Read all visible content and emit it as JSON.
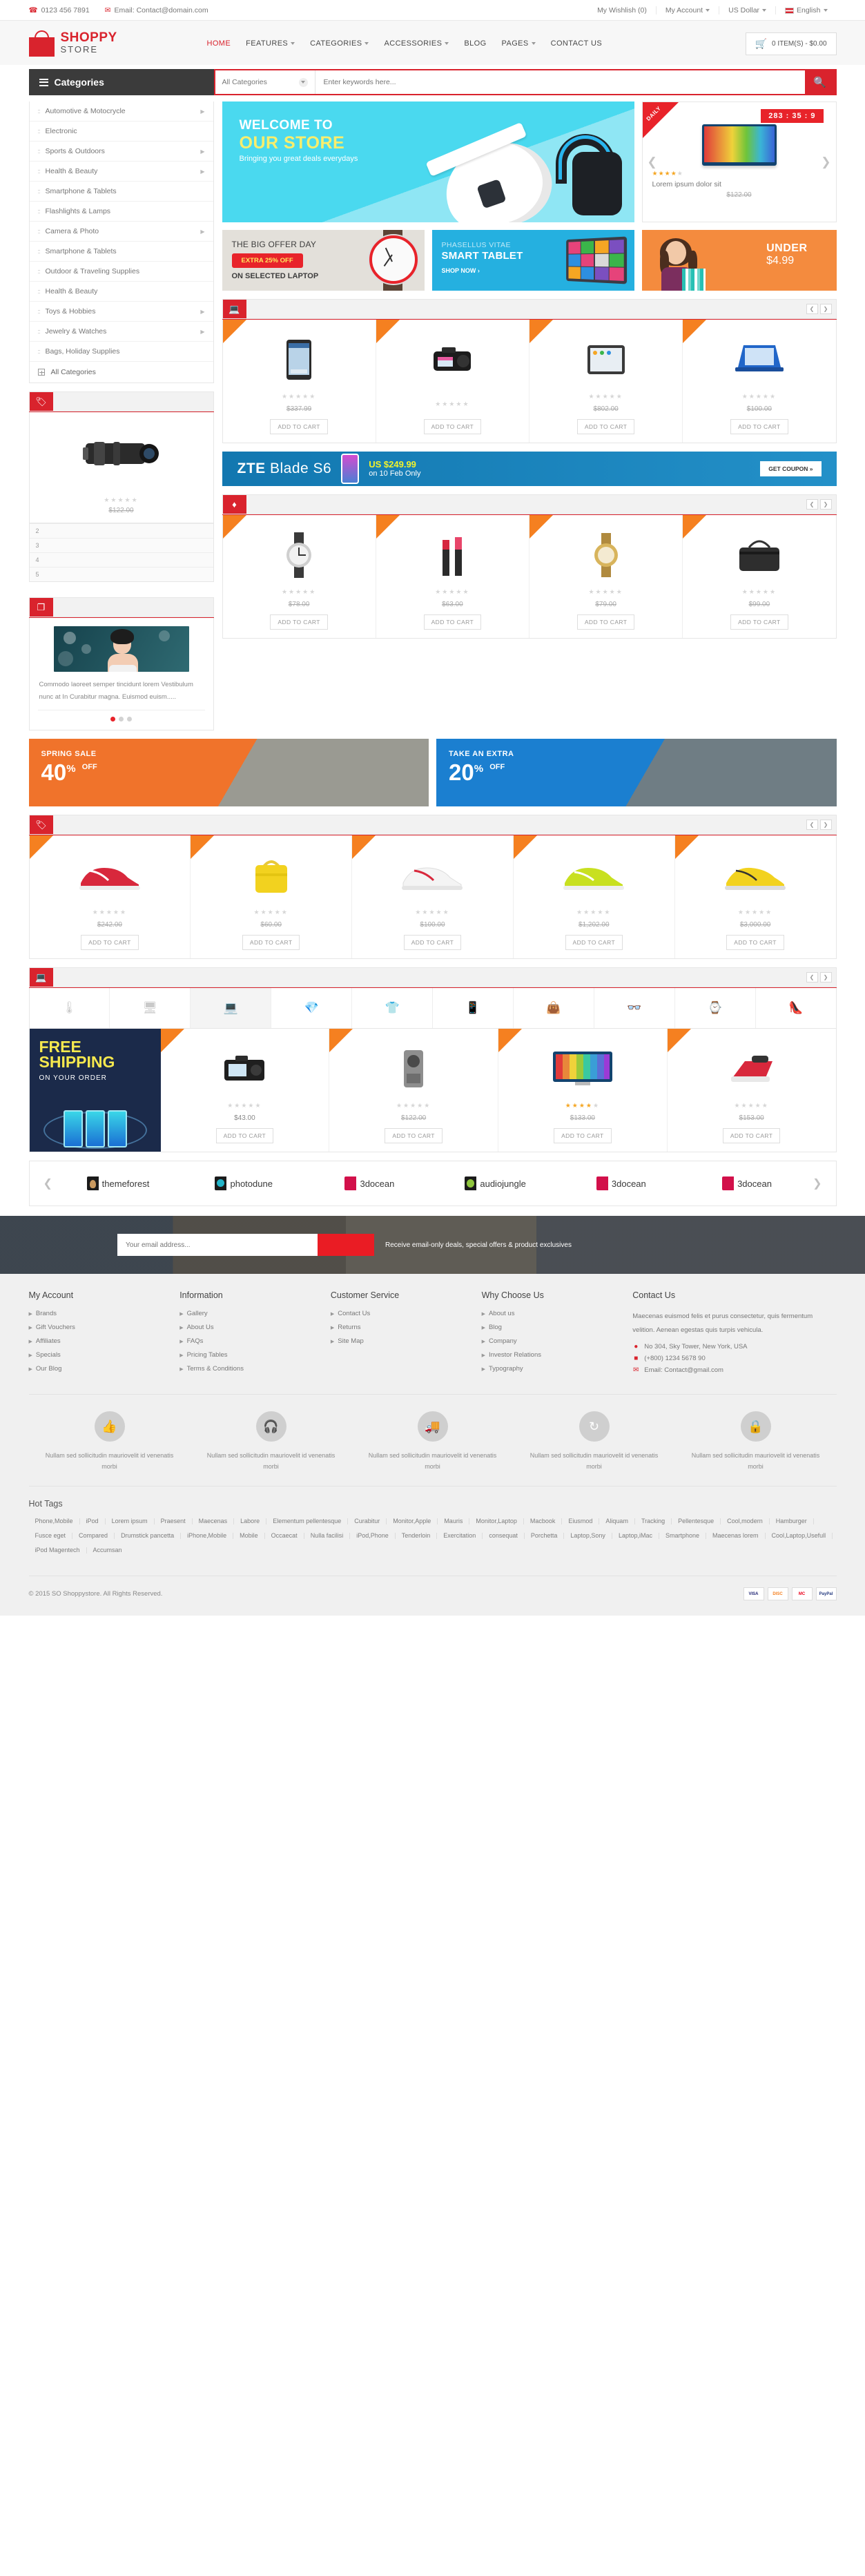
{
  "topbar": {
    "phone": "0123 456 7891",
    "email": "Email: Contact@domain.com",
    "wishlist": "My Wishlish (0)",
    "account": "My Account",
    "currency": "US Dollar",
    "language": "English"
  },
  "header": {
    "logo_main": "SHOPPY",
    "logo_sub": "STORE",
    "nav": [
      {
        "label": "HOME",
        "active": true,
        "caret": false
      },
      {
        "label": "FEATURES",
        "active": false,
        "caret": true
      },
      {
        "label": "CATEGORIES",
        "active": false,
        "caret": true
      },
      {
        "label": "ACCESSORIES",
        "active": false,
        "caret": true
      },
      {
        "label": "BLOG",
        "active": false,
        "caret": false
      },
      {
        "label": "PAGES",
        "active": false,
        "caret": true
      },
      {
        "label": "CONTACT US",
        "active": false,
        "caret": false
      }
    ],
    "cart": "0 ITEM(S) - $0.00"
  },
  "search": {
    "categories_button": "Categories",
    "select_value": "All Categories",
    "placeholder": "Enter keywords here...",
    "input_value": ""
  },
  "sidebar": {
    "items": [
      {
        "label": "Automotive & Motocrycle",
        "arrow": true
      },
      {
        "label": "Electronic",
        "arrow": false
      },
      {
        "label": "Sports & Outdoors",
        "arrow": true
      },
      {
        "label": "Health & Beauty",
        "arrow": true
      },
      {
        "label": "Smartphone & Tablets",
        "arrow": false
      },
      {
        "label": "Flashlights & Lamps",
        "arrow": false
      },
      {
        "label": "Camera & Photo",
        "arrow": true
      },
      {
        "label": "Smartphone & Tablets",
        "arrow": false
      },
      {
        "label": "Outdoor & Traveling Supplies",
        "arrow": false
      },
      {
        "label": "Health & Beauty",
        "arrow": false
      },
      {
        "label": "Toys & Hobbies",
        "arrow": true
      },
      {
        "label": "Jewelry & Watches",
        "arrow": true
      },
      {
        "label": "Bags, Holiday Supplies",
        "arrow": false
      }
    ],
    "all_categories": "All Categories"
  },
  "hero": {
    "line1": "WELCOME TO",
    "line2": "OUR STORE",
    "line3": "Bringing you great deals everydays"
  },
  "deal": {
    "ribbon": "DAILY",
    "countdown": "283 : 35 : 9",
    "name": "Lorem ipsum dolor sit",
    "price": "$122.00",
    "rating": 4
  },
  "promos": {
    "p1": {
      "title_bold": "THE BIG",
      "title_rest": " OFFER DAY",
      "badge": "EXTRA 25% OFF",
      "sub": "ON SELECTED LAPTOP"
    },
    "p2": {
      "line1": "PHASELLUS VITAE",
      "line2": "SMART TABLET",
      "cta": "SHOP NOW ›"
    },
    "p3": {
      "line1": "UNDER",
      "line2": "$4.99"
    }
  },
  "block1": {
    "icon": "monitor-icon",
    "sidebar_price": "$122.00",
    "sidebar_thumbs": [
      "2",
      "3",
      "4",
      "5"
    ],
    "products": [
      {
        "name": "LG Tablet",
        "price": "$337.99",
        "rating": 0,
        "cart": "ADD TO CART"
      },
      {
        "name": "DSLR Camera",
        "price": "",
        "rating": 0,
        "cart": "ADD TO CART"
      },
      {
        "name": "iPad Tablet",
        "price": "$802.00",
        "rating": 0,
        "cart": "ADD TO CART"
      },
      {
        "name": "Blue Laptop",
        "price": "$100.00",
        "rating": 0,
        "cart": "ADD TO CART"
      }
    ]
  },
  "zte": {
    "brand": "ZTE",
    "model": " Blade S6",
    "price": "US $249.99",
    "sub": "on 10 Feb Only",
    "coupon": "GET COUPON »"
  },
  "block2": {
    "icon": "copy-icon",
    "blog_text": "Commodo laoreet semper tincidunt lorem Vestibulum nunc at In Curabitur magna. Euismod euism.....",
    "products": [
      {
        "name": "Chrono Watch",
        "price": "$78.00",
        "rating": 0,
        "cart": "ADD TO CART"
      },
      {
        "name": "Lipstick Set",
        "price": "$63.00",
        "rating": 0,
        "cart": "ADD TO CART"
      },
      {
        "name": "Gold Watch",
        "price": "$79.00",
        "rating": 0,
        "cart": "ADD TO CART"
      },
      {
        "name": "Leather Handbag",
        "price": "$99.00",
        "rating": 0,
        "cart": "ADD TO CART"
      }
    ]
  },
  "sales": {
    "s1": {
      "title": "SPRING SALE",
      "num": "40",
      "pct": "%",
      "off": "OFF"
    },
    "s2": {
      "title": "TAKE AN EXTRA",
      "num": "20",
      "pct": "%",
      "off": "OFF"
    }
  },
  "block3": {
    "icon": "tag-icon",
    "products": [
      {
        "name": "Red Running Shoe",
        "price": "$242.00",
        "rating": 0,
        "cart": "ADD TO CART"
      },
      {
        "name": "Yellow Handbag",
        "price": "$60.00",
        "rating": 0,
        "cart": "ADD TO CART"
      },
      {
        "name": "White Sneakers",
        "price": "$100.00",
        "rating": 0,
        "cart": "ADD TO CART"
      },
      {
        "name": "Green Sneaker",
        "price": "$1,202.00",
        "rating": 0,
        "cart": "ADD TO CART"
      },
      {
        "name": "Football Boot",
        "price": "$3,000.00",
        "rating": 0,
        "cart": "ADD TO CART"
      }
    ]
  },
  "block4": {
    "icon": "monitor-icon",
    "tabs": [
      "thermometer-icon",
      "monitor-icon",
      "laptop-icon",
      "diamond-icon",
      "tshirt-icon",
      "tablet-icon",
      "bag-icon",
      "glasses-icon",
      "watch-icon",
      "heel-icon"
    ],
    "active_tab_index": 2,
    "shipping": {
      "line1": "FREE",
      "line2": "SHIPPING",
      "line3": "ON YOUR ORDER"
    },
    "products": [
      {
        "name": "Compact Camera",
        "price": "$43.00",
        "rating": 0,
        "cart": "ADD TO CART"
      },
      {
        "name": "Speaker",
        "price": "$122.00",
        "rating": 0,
        "cart": "ADD TO CART"
      },
      {
        "name": "Curved TV",
        "price": "$133.00",
        "rating": 4,
        "cart": "ADD TO CART"
      },
      {
        "name": "Steam Iron",
        "price": "$153.00",
        "rating": 0,
        "cart": "ADD TO CART"
      }
    ]
  },
  "brands": [
    "themeforest",
    "photodune",
    "3docean",
    "audiojungle",
    "3docean",
    "3docean"
  ],
  "newsletter": {
    "placeholder": "Your email address...",
    "value": "",
    "text": "Receive email-only deals, special offers & product exclusives"
  },
  "footer": {
    "columns": [
      {
        "title": "My Account",
        "links": [
          "Brands",
          "Gift Vouchers",
          "Affiliates",
          "Specials",
          "Our Blog"
        ]
      },
      {
        "title": "Information",
        "links": [
          "Gallery",
          "About Us",
          "FAQs",
          "Pricing Tables",
          "Terms & Conditions"
        ]
      },
      {
        "title": "Customer Service",
        "links": [
          "Contact Us",
          "Returns",
          "Site Map"
        ]
      },
      {
        "title": "Why Choose Us",
        "links": [
          "About us",
          "Blog",
          "Company",
          "Investor Relations",
          "Typography"
        ]
      }
    ],
    "contact": {
      "title": "Contact Us",
      "blurb": "Maecenas euismod felis et purus consectetur, quis fermentum velition. Aenean egestas quis turpis vehicula.",
      "address": "No 304, Sky Tower, New York, USA",
      "phone": "(+800) 1234 5678 90",
      "email": "Email: Contact@gmail.com"
    }
  },
  "services": [
    {
      "icon": "thumbs-up-icon",
      "text": "Nullam sed sollicitudin mauriovelit id venenatis morbi"
    },
    {
      "icon": "headset-icon",
      "text": "Nullam sed sollicitudin mauriovelit id venenatis morbi"
    },
    {
      "icon": "truck-icon",
      "text": "Nullam sed sollicitudin mauriovelit id venenatis morbi"
    },
    {
      "icon": "refresh-icon",
      "text": "Nullam sed sollicitudin mauriovelit id venenatis morbi"
    },
    {
      "icon": "lock-icon",
      "text": "Nullam sed sollicitudin mauriovelit id venenatis morbi"
    }
  ],
  "hot_tags": {
    "title": "Hot Tags",
    "tags": [
      "Phone,Mobile",
      "iPod",
      "Lorem ipsum",
      "Praesent",
      "Maecenas",
      "Labore",
      "Elementum pellentesque",
      "Curabitur",
      "Monitor,Apple",
      "Mauris",
      "Monitor,Laptop",
      "Macbook",
      "Eiusmod",
      "Aliquam",
      "Tracking",
      "Pellentesque",
      "Cool,modern",
      "Hamburger",
      "Fusce eget",
      "Compared",
      "Drumstick pancetta",
      "iPhone,Mobile",
      "Mobile",
      "Occaecat",
      "Nulla facilisi",
      "iPod,Phone",
      "Tenderloin",
      "Exercitation",
      "consequat",
      "Porchetta",
      "Laptop,Sony",
      "Laptop,iMac",
      "Smartphone",
      "Maecenas lorem",
      "Cool,Laptop,Usefull",
      "iPod Magentech",
      "Accumsan"
    ]
  },
  "copyright": "© 2015 SO Shoppystore. All Rights Reserved.",
  "payments": [
    "VISA",
    "DISCOVER",
    "MC",
    "PayPal"
  ]
}
